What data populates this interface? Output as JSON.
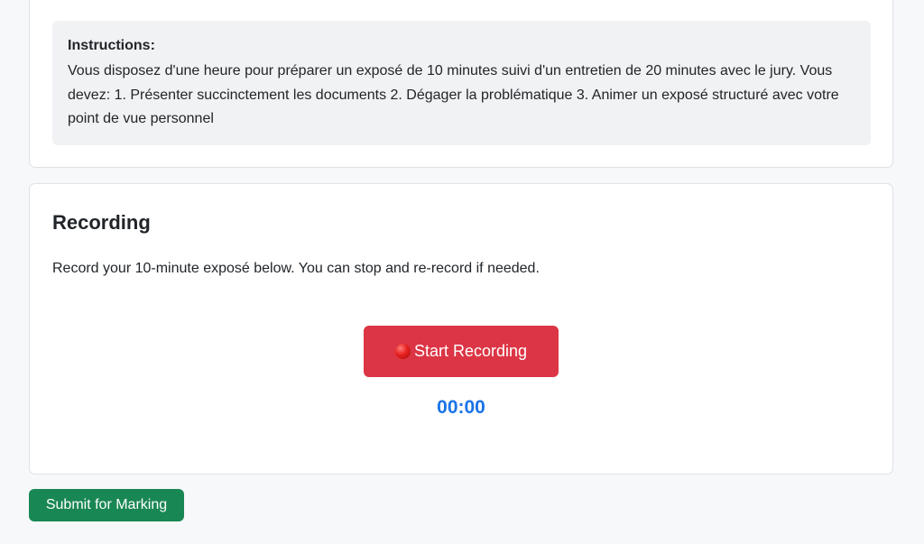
{
  "instructions": {
    "heading": "Instructions:",
    "text": "Vous disposez d'une heure pour préparer un exposé de 10 minutes suivi d'un entretien de 20 minutes avec le jury. Vous devez: 1. Présenter succinctement les documents 2. Dégager la problématique 3. Animer un exposé structuré avec votre point de vue personnel"
  },
  "recording": {
    "title": "Recording",
    "description": "Record your 10-minute exposé below. You can stop and re-record if needed.",
    "start_button_label": "Start Recording",
    "start_button_icon": "red-circle-icon",
    "timer": "00:00"
  },
  "actions": {
    "submit_label": "Submit for Marking"
  },
  "colors": {
    "record_button": "#dc3545",
    "submit_button": "#198754",
    "timer": "#1a73e8"
  }
}
